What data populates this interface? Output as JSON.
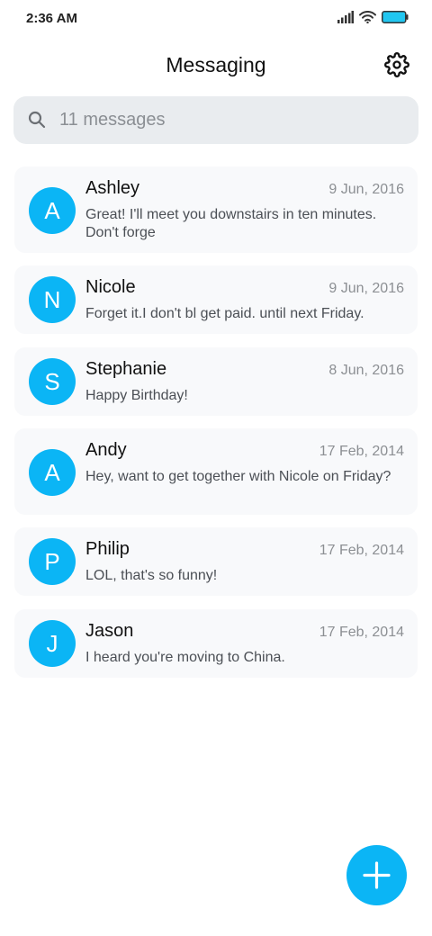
{
  "status_bar": {
    "time": "2:36 AM",
    "icons": [
      "signal-icon",
      "wifi-icon",
      "battery-icon"
    ],
    "battery_color": "#21c6f0"
  },
  "header": {
    "title": "Messaging",
    "settings_icon": "gear-icon"
  },
  "search": {
    "icon": "search-icon",
    "placeholder": "11 messages"
  },
  "colors": {
    "accent": "#0bb5f5",
    "card_background": "#f8f9fb",
    "search_background": "#e9ecef"
  },
  "threads": [
    {
      "initial": "A",
      "name": "Ashley",
      "date": "9 Jun, 2016",
      "preview": "Great! I'll meet you downstairs in ten minutes. Don't forge"
    },
    {
      "initial": "N",
      "name": "Nicole",
      "date": "9 Jun, 2016",
      "preview": "Forget it.I don't bl get paid. until next Friday."
    },
    {
      "initial": "S",
      "name": "Stephanie",
      "date": "8 Jun, 2016",
      "preview": "Happy Birthday!"
    },
    {
      "initial": "A",
      "name": "Andy",
      "date": "17 Feb, 2014",
      "preview": "Hey, want to get together with Nicole on Friday?"
    },
    {
      "initial": "P",
      "name": "Philip",
      "date": "17 Feb, 2014",
      "preview": "LOL, that's so funny!"
    },
    {
      "initial": "J",
      "name": "Jason",
      "date": "17 Feb, 2014",
      "preview": "I heard you're moving to China."
    }
  ],
  "fab": {
    "icon": "plus-icon"
  }
}
